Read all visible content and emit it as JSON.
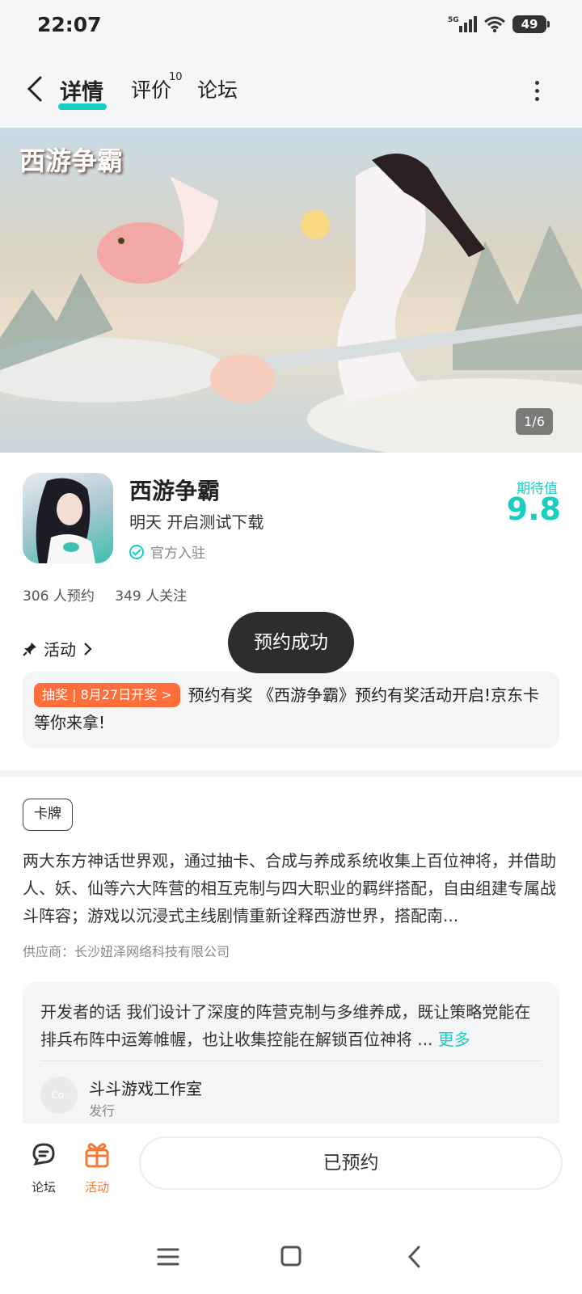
{
  "status_bar": {
    "time": "22:07",
    "network": "5G",
    "battery": "49"
  },
  "header": {
    "tabs": [
      {
        "label": "详情",
        "active": true
      },
      {
        "label": "评价",
        "badge": "10"
      },
      {
        "label": "论坛"
      }
    ]
  },
  "banner": {
    "logo_text": "西游争霸",
    "counter": "1/6"
  },
  "app": {
    "name": "西游争霸",
    "subtitle": "明天 开启测试下载",
    "official_label": "官方入驻",
    "expect_label": "期待值",
    "expect_score": "9.8",
    "reservations": "306 人预约",
    "followers": "349 人关注"
  },
  "activity": {
    "title": "活动",
    "tag": "抽奖 | 8月27日开奖 >",
    "text": "预约有奖 《西游争霸》预约有奖活动开启!京东卡等你来拿!"
  },
  "toast": "预约成功",
  "details": {
    "genre": "卡牌",
    "description": "两大东方神话世界观，通过抽卡、合成与养成系统收集上百位神将，并借助人、妖、仙等六大阵营的相互克制与四大职业的羁绊搭配，自由组建专属战斗阵容；游戏以沉浸式主线剧情重新诠释西游世界，搭配南...",
    "supplier": "供应商：长沙妞泽网络科技有限公司"
  },
  "developer": {
    "text": "开发者的话  我们设计了深度的阵营克制与多维养成，既让策略党能在排兵布阵中运筹帷幄，也让收集控能在解锁百位神将 ...",
    "more": "更多",
    "studio_avatar": "Co.",
    "studio_name": "斗斗游戏工作室",
    "studio_role": "发行"
  },
  "bottom_bar": {
    "forum_label": "论坛",
    "activity_label": "活动",
    "reserve_button": "已预约"
  },
  "colors": {
    "accent": "#19cdc0",
    "promo": "#ff6d3a",
    "activity_icon": "#f07a3a"
  }
}
